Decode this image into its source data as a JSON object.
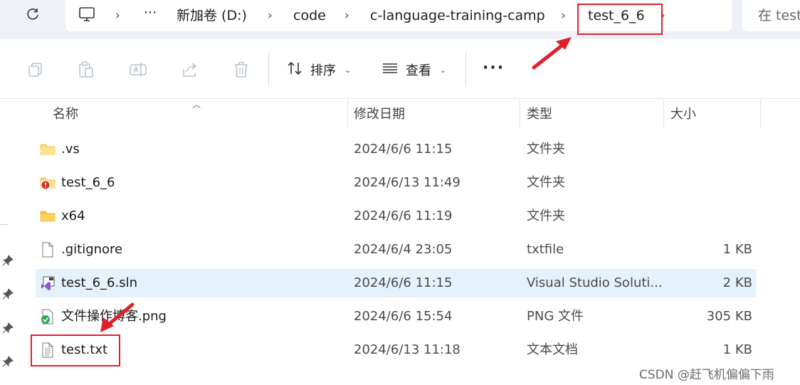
{
  "breadcrumb": {
    "more": "···",
    "items": [
      "新加卷 (D:)",
      "code",
      "c-language-training-camp",
      "test_6_6"
    ]
  },
  "search": {
    "placeholder": "在 test"
  },
  "toolbar": {
    "sort_label": "排序",
    "view_label": "查看",
    "more_label": "···"
  },
  "columns": {
    "name": "名称",
    "modified": "修改日期",
    "type": "类型",
    "size": "大小"
  },
  "files": [
    {
      "name": ".vs",
      "modified": "2024/6/6 11:15",
      "type": "文件夹",
      "size": "",
      "icon": "folder-icon"
    },
    {
      "name": "test_6_6",
      "modified": "2024/6/13 11:49",
      "type": "文件夹",
      "size": "",
      "icon": "folder-warning-icon"
    },
    {
      "name": "x64",
      "modified": "2024/6/6 11:19",
      "type": "文件夹",
      "size": "",
      "icon": "folder-icon"
    },
    {
      "name": ".gitignore",
      "modified": "2024/6/4 23:05",
      "type": "txtfile",
      "size": "1 KB",
      "icon": "blank-file-icon"
    },
    {
      "name": "test_6_6.sln",
      "modified": "2024/6/6 11:15",
      "type": "Visual Studio Soluti...",
      "size": "2 KB",
      "icon": "visual-studio-solution-icon"
    },
    {
      "name": "文件操作博客.png",
      "modified": "2024/6/6 15:54",
      "type": "PNG 文件",
      "size": "305 KB",
      "icon": "png-file-icon"
    },
    {
      "name": "test.txt",
      "modified": "2024/6/13 11:18",
      "type": "文本文档",
      "size": "1 KB",
      "icon": "text-file-icon"
    }
  ],
  "watermark": "CSDN @赶飞机偏偏下雨",
  "colors": {
    "highlight": "#e0202b",
    "selected_row": "#e5f1fb",
    "address_bg": "#eef2f7"
  }
}
